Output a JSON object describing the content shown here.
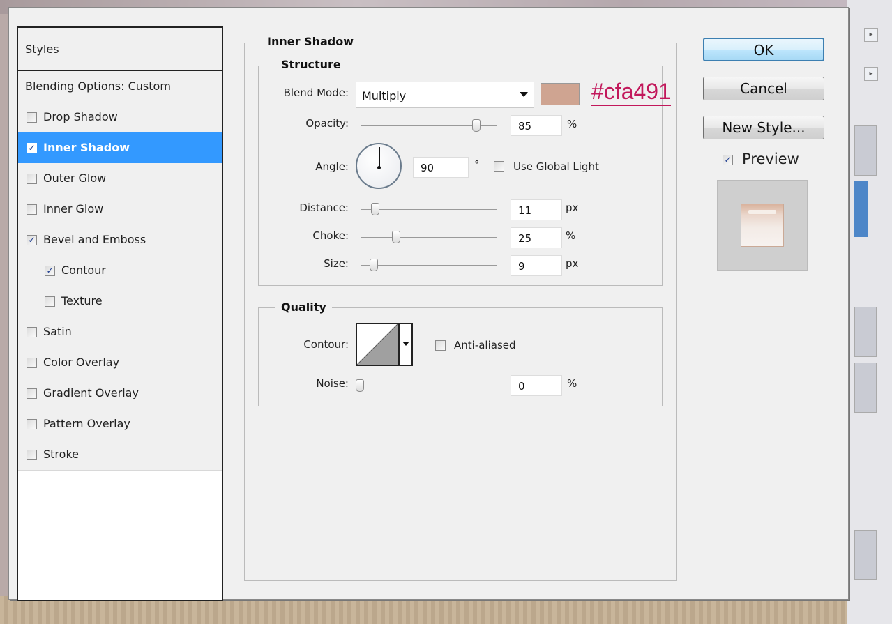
{
  "dialog": {
    "styles_header": "Styles",
    "blending_options": "Blending Options: Custom",
    "style_items": [
      {
        "label": "Drop Shadow",
        "checked": false,
        "selected": false,
        "indent": false
      },
      {
        "label": "Inner Shadow",
        "checked": true,
        "selected": true,
        "indent": false
      },
      {
        "label": "Outer Glow",
        "checked": false,
        "selected": false,
        "indent": false
      },
      {
        "label": "Inner Glow",
        "checked": false,
        "selected": false,
        "indent": false
      },
      {
        "label": "Bevel and Emboss",
        "checked": true,
        "selected": false,
        "indent": false
      },
      {
        "label": "Contour",
        "checked": true,
        "selected": false,
        "indent": true
      },
      {
        "label": "Texture",
        "checked": false,
        "selected": false,
        "indent": true
      },
      {
        "label": "Satin",
        "checked": false,
        "selected": false,
        "indent": false
      },
      {
        "label": "Color Overlay",
        "checked": false,
        "selected": false,
        "indent": false
      },
      {
        "label": "Gradient Overlay",
        "checked": false,
        "selected": false,
        "indent": false
      },
      {
        "label": "Pattern Overlay",
        "checked": false,
        "selected": false,
        "indent": false
      },
      {
        "label": "Stroke",
        "checked": false,
        "selected": false,
        "indent": false
      }
    ]
  },
  "inner_shadow": {
    "title": "Inner Shadow",
    "structure": {
      "title": "Structure",
      "blend_mode_label": "Blend Mode:",
      "blend_mode_value": "Multiply",
      "color_swatch": "#cfa491",
      "color_note": "#cfa491",
      "opacity_label": "Opacity:",
      "opacity_value": "85",
      "opacity_unit": "%",
      "angle_label": "Angle:",
      "angle_value": "90",
      "angle_unit": "°",
      "use_global_light_label": "Use Global Light",
      "use_global_light_checked": false,
      "distance_label": "Distance:",
      "distance_value": "11",
      "distance_unit": "px",
      "choke_label": "Choke:",
      "choke_value": "25",
      "choke_unit": "%",
      "size_label": "Size:",
      "size_value": "9",
      "size_unit": "px"
    },
    "quality": {
      "title": "Quality",
      "contour_label": "Contour:",
      "anti_aliased_label": "Anti-aliased",
      "anti_aliased_checked": false,
      "noise_label": "Noise:",
      "noise_value": "0",
      "noise_unit": "%"
    }
  },
  "buttons": {
    "ok": "OK",
    "cancel": "Cancel",
    "new_style": "New Style...",
    "preview_label": "Preview",
    "preview_checked": true
  },
  "colors": {
    "selection": "#3399ff",
    "shadow_color": "#cfa491",
    "annotation": "#c2185b"
  }
}
